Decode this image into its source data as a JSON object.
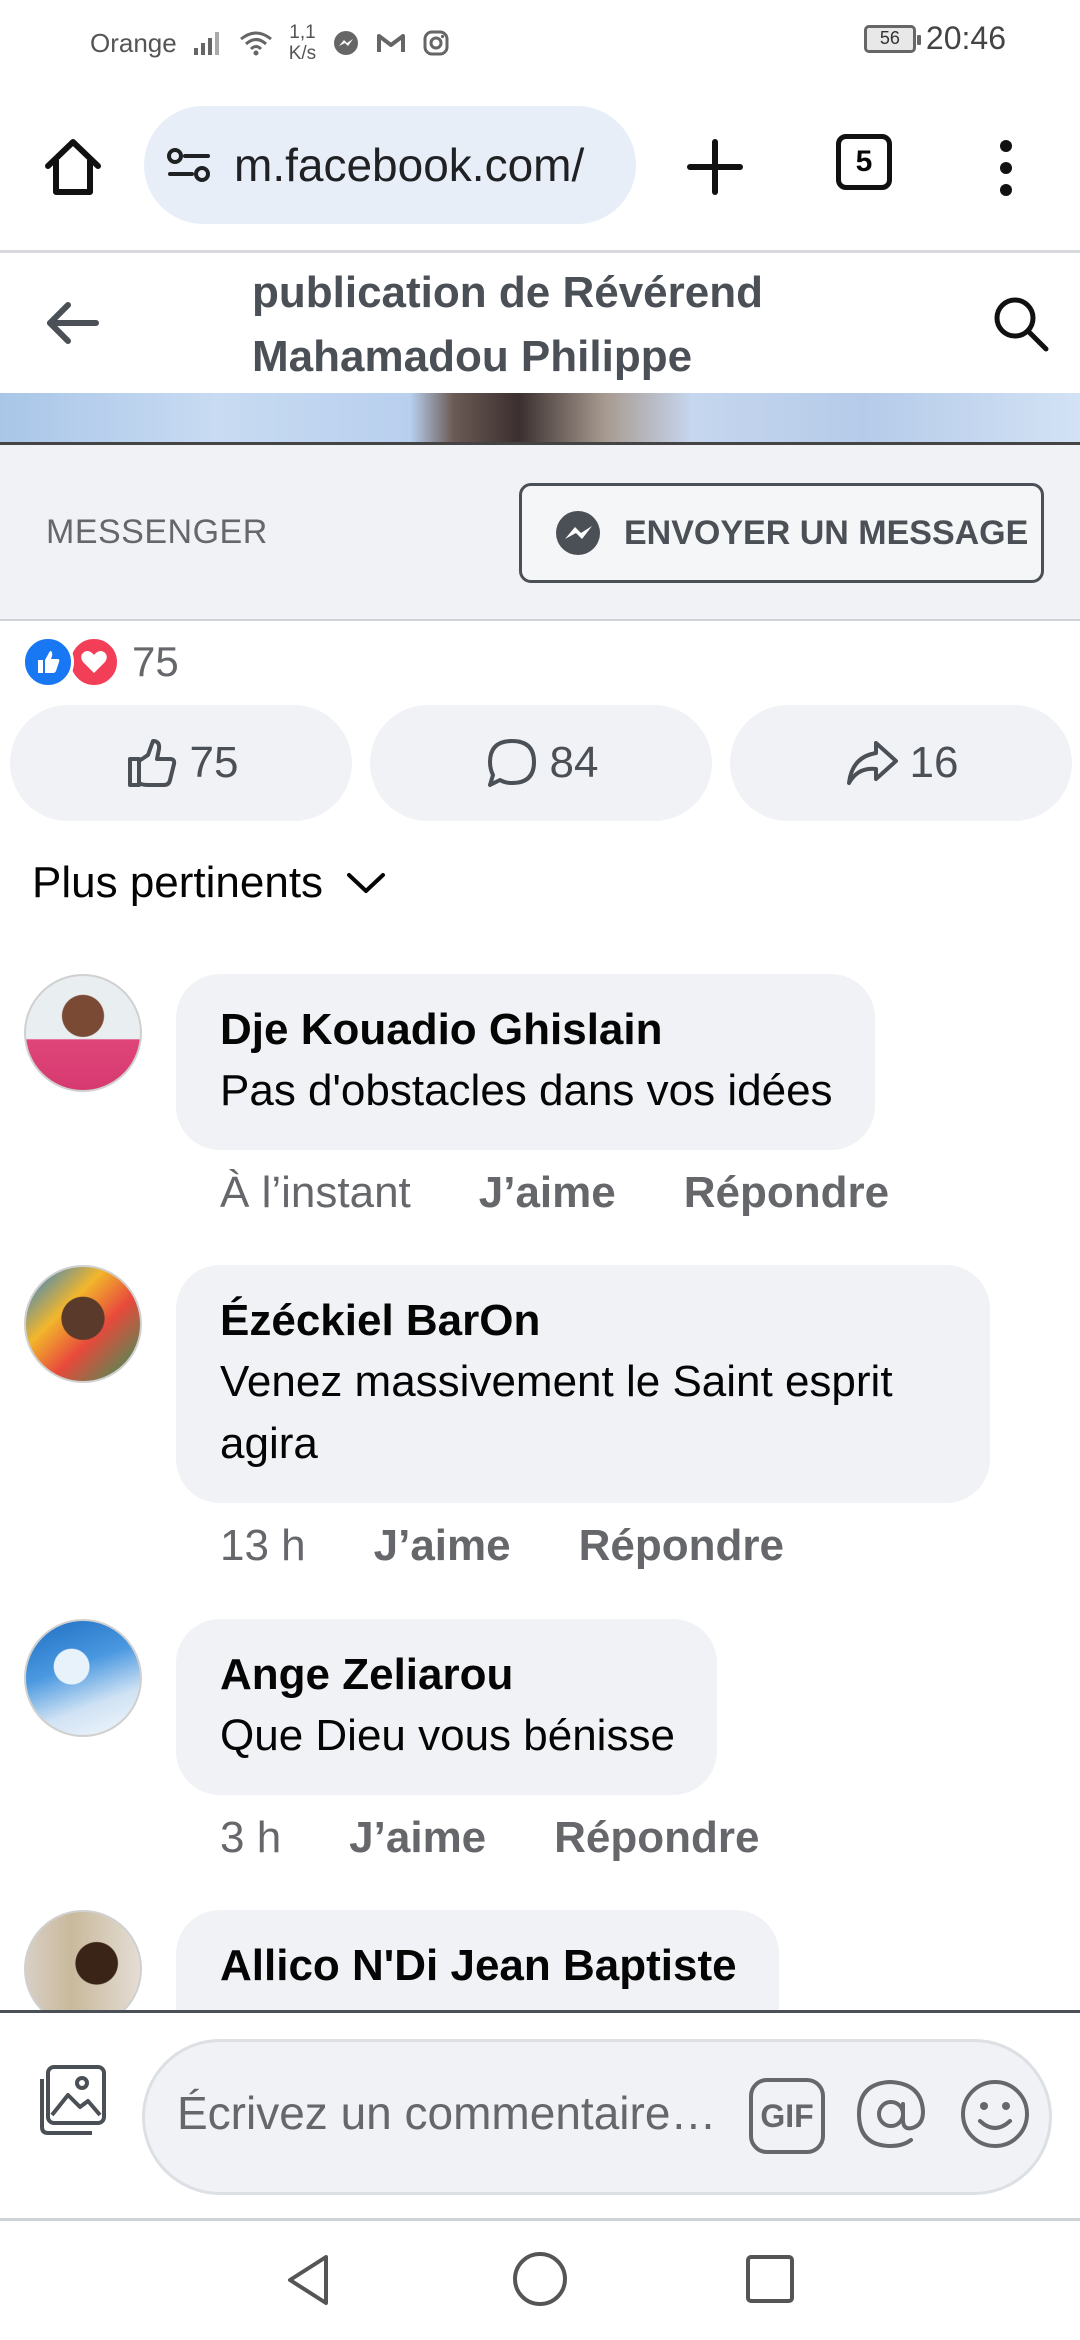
{
  "status_bar": {
    "carrier": "Orange",
    "speed_value": "1,1",
    "speed_unit": "K/s",
    "battery": "56",
    "time": "20:46",
    "icons": [
      "signal-icon",
      "wifi-icon",
      "messenger-notif-icon",
      "gmail-notif-icon",
      "instagram-notif-icon"
    ]
  },
  "browser": {
    "url": "m.facebook.com/",
    "tab_count": "5",
    "icons": [
      "home-icon",
      "site-settings-icon",
      "plus-icon",
      "tabs-icon",
      "more-vert-icon"
    ]
  },
  "header": {
    "title": "publication de Révérend Mahamadou Philippe"
  },
  "messenger_bar": {
    "label": "MESSENGER",
    "button_label": "ENVOYER UN MESSAGE"
  },
  "reactions": {
    "count": "75",
    "types": [
      "like",
      "love"
    ]
  },
  "actions": {
    "like_count": "75",
    "comment_count": "84",
    "share_count": "16"
  },
  "sort": {
    "label": "Plus pertinents"
  },
  "comments": [
    {
      "name": "Dje Kouadio Ghislain",
      "text": "Pas d'obstacles dans vos idées",
      "time": "À l’instant",
      "like_label": "J’aime",
      "reply_label": "Répondre"
    },
    {
      "name": "Ézéckiel BarOn",
      "text": "Venez massivement le Saint esprit agira",
      "time": "13 h",
      "like_label": "J’aime",
      "reply_label": "Répondre"
    },
    {
      "name": "Ange Zeliarou",
      "text": "Que Dieu vous bénisse",
      "time": "3 h",
      "like_label": "J’aime",
      "reply_label": "Répondre"
    },
    {
      "name": "Allico N'Di Jean Baptiste"
    }
  ],
  "composer": {
    "placeholder": "Écrivez un commentaire…",
    "gif_label": "GIF"
  },
  "colors": {
    "facebook_blue": "#1877f2",
    "love_red": "#f33e58",
    "bubble_gray": "#f0f2f5",
    "secondary_text": "#65676b"
  }
}
